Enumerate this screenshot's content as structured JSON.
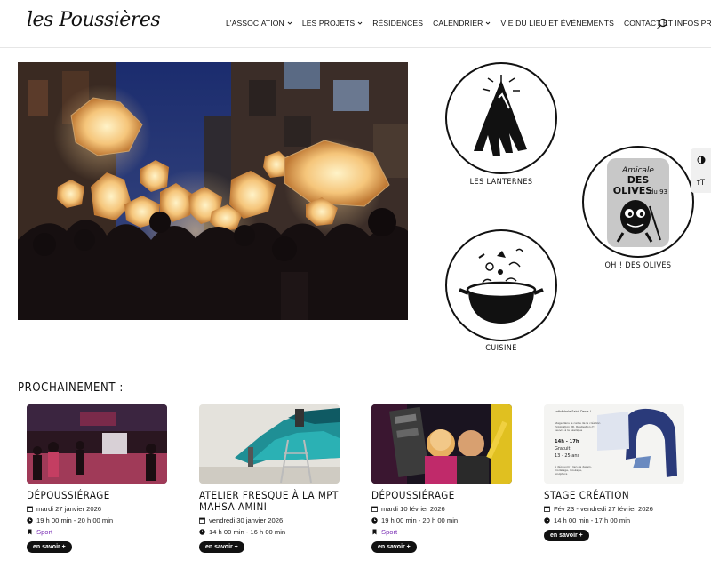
{
  "brand": {
    "logo_text": "les Poussières"
  },
  "nav": {
    "items": [
      {
        "label": "L'ASSOCIATION",
        "dropdown": true
      },
      {
        "label": "LES PROJETS",
        "dropdown": true
      },
      {
        "label": "RÉSIDENCES",
        "dropdown": false
      },
      {
        "label": "CALENDRIER",
        "dropdown": true
      },
      {
        "label": "VIE DU LIEU ET ÉVÉNEMENTS",
        "dropdown": false
      },
      {
        "label": "CONTACT ET INFOS PRATIQUES",
        "dropdown": false
      }
    ]
  },
  "projects": [
    {
      "label": "LES LANTERNES",
      "icon": "lantern-figure-icon"
    },
    {
      "label": "OH ! DES OLIVES",
      "icon": "olive-mascot-icon",
      "badge_text": "Amicale DES OLIVES du 93"
    },
    {
      "label": "CUISINE",
      "icon": "cooking-pot-icon"
    }
  ],
  "accessibility": {
    "contrast": "contrast-toggle-icon",
    "font": "font-size-icon",
    "font_glyph": "ᴛT"
  },
  "upcoming": {
    "title": "PROCHAINEMENT :",
    "events": [
      {
        "title": "DÉPOUSSIÉRAGE",
        "date": "mardi 27 janvier 2026",
        "time": "19 h 00 min - 20 h 00 min",
        "category": "Sport",
        "button": "en savoir +"
      },
      {
        "title": "ATELIER FRESQUE À LA MPT MAHSA AMINI",
        "date": "vendredi 30 janvier 2026",
        "time": "14 h 00 min - 16 h 00 min",
        "category": "",
        "button": "en savoir +"
      },
      {
        "title": "DÉPOUSSIÉRAGE",
        "date": "mardi 10 février 2026",
        "time": "19 h 00 min - 20 h 00 min",
        "category": "Sport",
        "button": "en savoir +"
      },
      {
        "title": "STAGE CRÉATION",
        "date": "Fév 23 - vendredi 27 février 2026",
        "time": "14 h 00 min - 17 h 00 min",
        "category": "",
        "button": "en savoir +"
      }
    ],
    "poster_text": [
      "cathédrale Saint Denis !",
      "Stage dans le cadre de la création",
      "Exploration 3D. Réalisation d'1",
      "oeuvre à la basilique",
      "14h - 17h",
      "Gratuit",
      "13 - 25 ans",
      "À découvrir : lien de dessin,",
      "modelage, moulage,",
      "Sculpture"
    ]
  },
  "colors": {
    "accent_category": "#7a2fb4",
    "button_bg": "#111111"
  }
}
